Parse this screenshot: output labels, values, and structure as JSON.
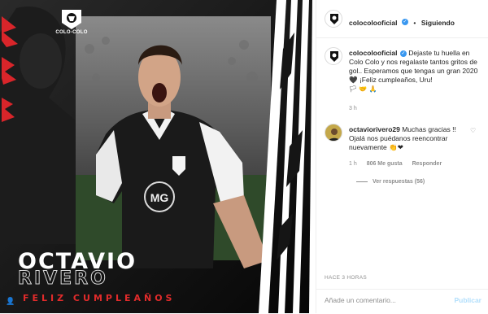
{
  "media": {
    "club_logo_text": "COLO-COLO",
    "player_first_name": "OCTAVIO",
    "player_last_name": "RIVERO",
    "birthday_text": "FELIZ CUMPLEAÑOS",
    "sponsor_logo": "MG",
    "tag_icon": "user-tag-icon"
  },
  "header": {
    "username": "colocolooficial",
    "separator": "•",
    "follow_state": "Siguiendo"
  },
  "caption": {
    "username": "colocolooficial",
    "text": "Dejaste tu huella en Colo Colo y nos regalaste tantos gritos de gol.. Esperamos que tengas un gran 2020 🖤 ¡Feliz cumpleaños, Uru!",
    "emojis": "🏳 🤝 🙏",
    "time": "3 h"
  },
  "comment": {
    "username": "octaviorivero29",
    "text": "Muchas gracias !! Ojalá nos puédanos reencontrar nuevamente 👏❤",
    "time": "1 h",
    "likes": "806 Me gusta",
    "reply_label": "Responder",
    "view_replies": "Ver respuestas (56)"
  },
  "post_time": "HACE 3 HORAS",
  "comment_box": {
    "placeholder": "Añade un comentario...",
    "publish_label": "Publicar"
  },
  "colors": {
    "accent_red": "#e12b2b",
    "verified_blue": "#3897f0",
    "publish_disabled": "#b2dffc"
  }
}
